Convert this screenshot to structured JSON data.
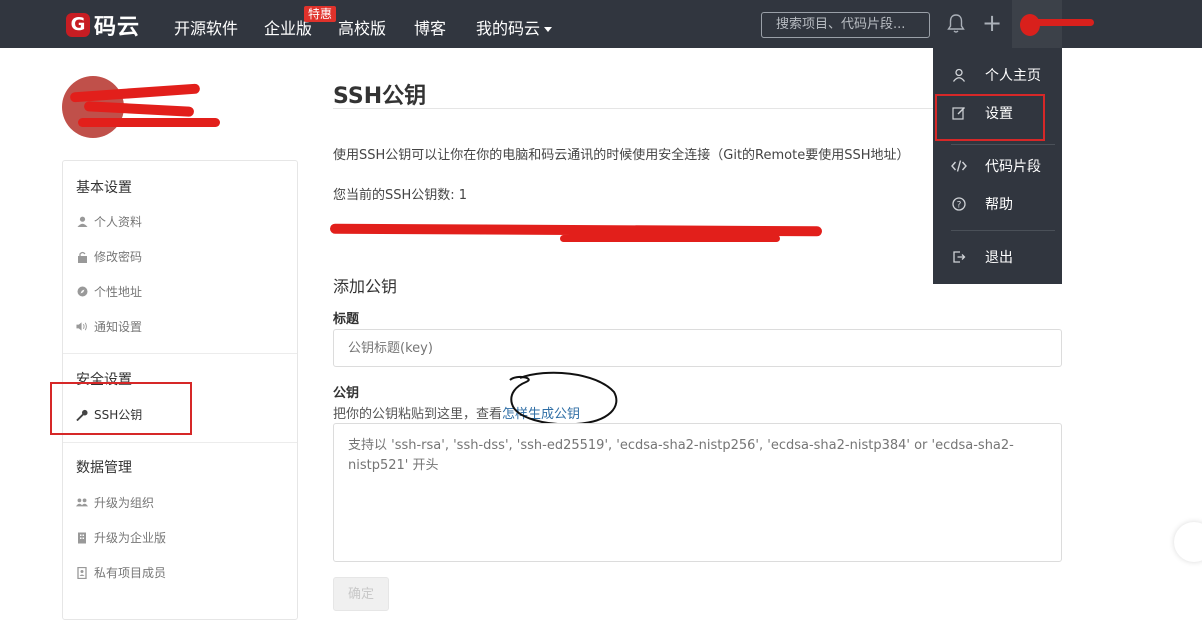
{
  "topnav": {
    "logo_mark": "G",
    "logo_text": "码云",
    "items": [
      "开源软件",
      "企业版",
      "高校版",
      "博客"
    ],
    "badge": "特惠",
    "my_menu": "我的码云",
    "search_placeholder": "搜索项目、代码片段..."
  },
  "dropdown": {
    "items": [
      {
        "label": "个人主页",
        "icon": "user-icon"
      },
      {
        "label": "设置",
        "icon": "edit-icon"
      },
      {
        "label": "代码片段",
        "icon": "code-icon"
      },
      {
        "label": "帮助",
        "icon": "help-icon"
      },
      {
        "label": "退出",
        "icon": "logout-icon"
      }
    ]
  },
  "sidebar": {
    "basic_title": "基本设置",
    "basic_items": [
      "个人资料",
      "修改密码",
      "个性地址",
      "通知设置"
    ],
    "security_title": "安全设置",
    "security_items": [
      "SSH公钥"
    ],
    "data_title": "数据管理",
    "data_items": [
      "升级为组织",
      "升级为企业版",
      "私有项目成员"
    ]
  },
  "main": {
    "title": "SSH公钥",
    "description": "使用SSH公钥可以让你在你的电脑和码云通讯的时候使用安全连接（Git的Remote要使用SSH地址）",
    "count_label": "您当前的SSH公钥数: 1",
    "add_title": "添加公钥",
    "title_label": "标题",
    "title_placeholder": "公钥标题(key)",
    "key_label": "公钥",
    "key_hint_prefix": "把你的公钥粘贴到这里，查看",
    "key_hint_link": "怎样生成公钥",
    "key_placeholder": "支持以 'ssh-rsa', 'ssh-dss', 'ssh-ed25519', 'ecdsa-sha2-nistp256', 'ecdsa-sha2-nistp384' or 'ecdsa-sha2-nistp521' 开头",
    "submit_label": "确定"
  },
  "colors": {
    "topbar": "#31363f",
    "brand_red": "#c71d23",
    "link": "#2f6ea5",
    "annotation": "#d62828"
  }
}
